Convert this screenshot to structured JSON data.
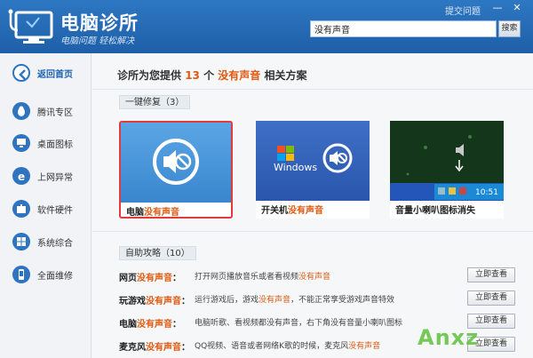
{
  "header": {
    "title": "电脑诊所",
    "subtitle": "电脑问题 轻松解决",
    "feedback_label": "提交问题",
    "minimize": "—",
    "close": "✕",
    "search_value": "没有声音",
    "search_button": "搜索"
  },
  "sidebar": {
    "items": [
      {
        "label": "返回首页",
        "icon": "back-arrow-icon"
      },
      {
        "label": "腾讯专区",
        "icon": "penguin-icon"
      },
      {
        "label": "桌面图标",
        "icon": "monitor-icon"
      },
      {
        "label": "上网异常",
        "icon": "ie-icon"
      },
      {
        "label": "软件硬件",
        "icon": "puzzle-icon"
      },
      {
        "label": "系统综合",
        "icon": "windows-icon"
      },
      {
        "label": "全面维修",
        "icon": "phone-icon"
      }
    ]
  },
  "results": {
    "prefix": "诊所为您提供",
    "count": "13",
    "middle": "个",
    "keyword": "没有声音",
    "suffix": "相关方案"
  },
  "quick_fix": {
    "header": "一键修复（3）",
    "cards": [
      {
        "prefix": "电脑",
        "keyword": "没有声音"
      },
      {
        "prefix": "开关机",
        "keyword": "没有声音"
      },
      {
        "prefix": "音量小喇叭图标消失",
        "keyword": ""
      }
    ],
    "windows_text": "Windows",
    "tray_time": "10:51"
  },
  "guides": {
    "header": "自助攻略（10）",
    "button_label": "立即查看",
    "rows": [
      {
        "title_prefix": "网页",
        "title_kw": "没有声音",
        "desc_a": "打开网页播放音乐或者看视频",
        "desc_kw": "没有声音",
        "desc_b": ""
      },
      {
        "title_prefix": "玩游戏",
        "title_kw": "没有声音",
        "desc_a": "运行游戏后，游戏",
        "desc_kw": "没有声音",
        "desc_b": "，不能正常享受游戏声音特效"
      },
      {
        "title_prefix": "电脑",
        "title_kw": "没有声音",
        "desc_a": "电脑听歌、看视频都没有声音，右下角没有音量小喇叭图标",
        "desc_kw": "",
        "desc_b": ""
      },
      {
        "title_prefix": "麦克风",
        "title_kw": "没有声音",
        "desc_a": "QQ视频、语音或者网络K歌的时候，麦克风",
        "desc_kw": "没有声音",
        "desc_b": ""
      }
    ]
  },
  "watermark": "Anxz",
  "colors": {
    "header": "#2e77c2",
    "accent": "#e05a12",
    "selected_border": "#e23b3b"
  }
}
